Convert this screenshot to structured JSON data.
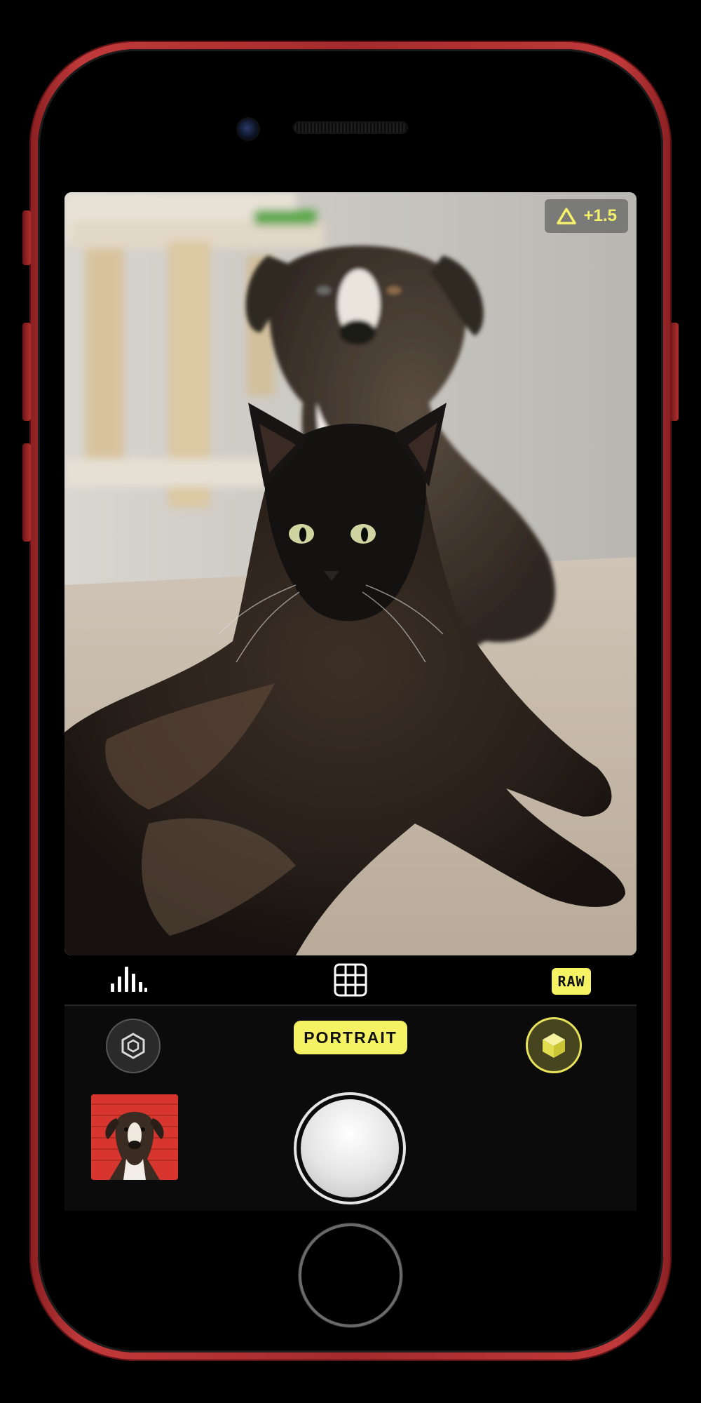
{
  "camera": {
    "mode_label": "PORTRAIT",
    "exposure_value": "+1.5",
    "raw_label": "RAW"
  },
  "icons": {
    "exposure": "triangle-exposure-icon",
    "histogram": "histogram-icon",
    "grid": "grid-icon",
    "portrait_lighting": "hexagon-lighting-icon",
    "depth": "cube-depth-icon",
    "shutter": "shutter-button"
  },
  "colors": {
    "accent_yellow": "#f5f264",
    "phone_red": "#b3302f",
    "thumbnail_bg": "#d8352e"
  }
}
